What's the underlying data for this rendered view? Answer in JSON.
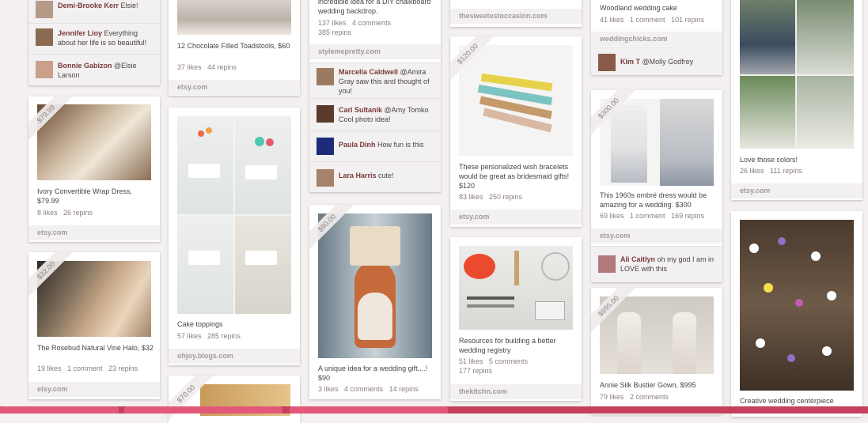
{
  "col1": {
    "comments_top": [
      {
        "user": "Demi-Brooke Kerr",
        "text": "Elsie!"
      },
      {
        "user": "Jennifer Lioy",
        "text": "Everything about her life is so beautiful!"
      },
      {
        "user": "Bonnie Gabizon",
        "text": "@Elsie Larson"
      }
    ],
    "pin1": {
      "price": "$79.99",
      "desc": "Ivory Convertible Wrap Dress, $79.99",
      "likes": "8 likes",
      "repins": "26 repins",
      "source": "etsy.com"
    },
    "pin2": {
      "price": "$32.00",
      "desc": "The Rosebud Natural Vine Halo, $32",
      "likes": "19 likes",
      "comments": "1 comment",
      "repins": "23 repins",
      "source": "etsy.com"
    }
  },
  "col2": {
    "pin0": {
      "desc": "12 Chocolate Filled Toadstools, $60",
      "likes": "37 likes",
      "repins": "44 repins",
      "source": "etsy.com"
    },
    "pin1": {
      "desc": "Cake toppings",
      "likes": "57 likes",
      "repins": "285 repins",
      "source": "ohjoy.blogs.com"
    },
    "pin2": {
      "price": "$70.00"
    }
  },
  "col3": {
    "pin0": {
      "desc": "incredible idea for a DIY chalkboard wedding backdrop.",
      "likes": "137 likes",
      "comments": "4 comments",
      "repins": "385 repins",
      "source": "stylemepretty.com"
    },
    "comments": [
      {
        "user": "Marcella Caldwell",
        "text": "@Amira Gray saw this and thought of you!"
      },
      {
        "user": "Cari Sultanik",
        "text": "@Amy Tomko Cool photo idea!"
      },
      {
        "user": "Paula Dinh",
        "text": "How fun is this"
      },
      {
        "user": "Lara Harris",
        "text": "cute!"
      }
    ],
    "pin1": {
      "price": "$90.00",
      "desc": "A unique idea for a wedding gift....! $90",
      "likes": "3 likes",
      "comments": "4 comments",
      "repins": "14 repins"
    }
  },
  "col4": {
    "pin0": {
      "source": "thesweetestoccasion.com"
    },
    "pin1": {
      "price": "$120.00",
      "desc": "These personalized wish bracelets would be great as bridesmaid gifts! $120",
      "likes": "83 likes",
      "repins": "250 repins",
      "source": "etsy.com"
    },
    "pin2": {
      "desc": "Resources for building a better wedding registry",
      "likes": "51 likes",
      "comments": "5 comments",
      "repins": "177 repins",
      "source": "thekitchn.com"
    }
  },
  "col5": {
    "pin0": {
      "desc": "Woodland wedding cake",
      "likes": "41 likes",
      "comments": "1 comment",
      "repins": "101 repins",
      "source": "weddingchicks.com"
    },
    "comment0": {
      "user": "Kim T",
      "text": "@Molly Godfrey"
    },
    "pin1": {
      "price": "$300.00",
      "desc": "This 1960s ombré dress would be amazing for a wedding. $300",
      "likes": "69 likes",
      "comments": "1 comment",
      "repins": "169 repins",
      "source": "etsy.com"
    },
    "comment1": {
      "user": "Ali Caitlyn",
      "text": "oh my god I am in LOVE with this"
    },
    "pin2": {
      "price": "$995.00",
      "desc": "Annie Silk Bustier Gown, $995",
      "likes": "79 likes",
      "comments": "2 comments"
    }
  },
  "col6": {
    "pin0": {
      "desc": "Love those colors!",
      "likes": "26 likes",
      "repins": "111 repins",
      "source": "etsy.com"
    },
    "pin1": {
      "desc": "Creative wedding centerpiece"
    }
  },
  "colors": {
    "brand": "#c4405c",
    "username": "#7a3a3a",
    "background": "#f3f0ef"
  }
}
